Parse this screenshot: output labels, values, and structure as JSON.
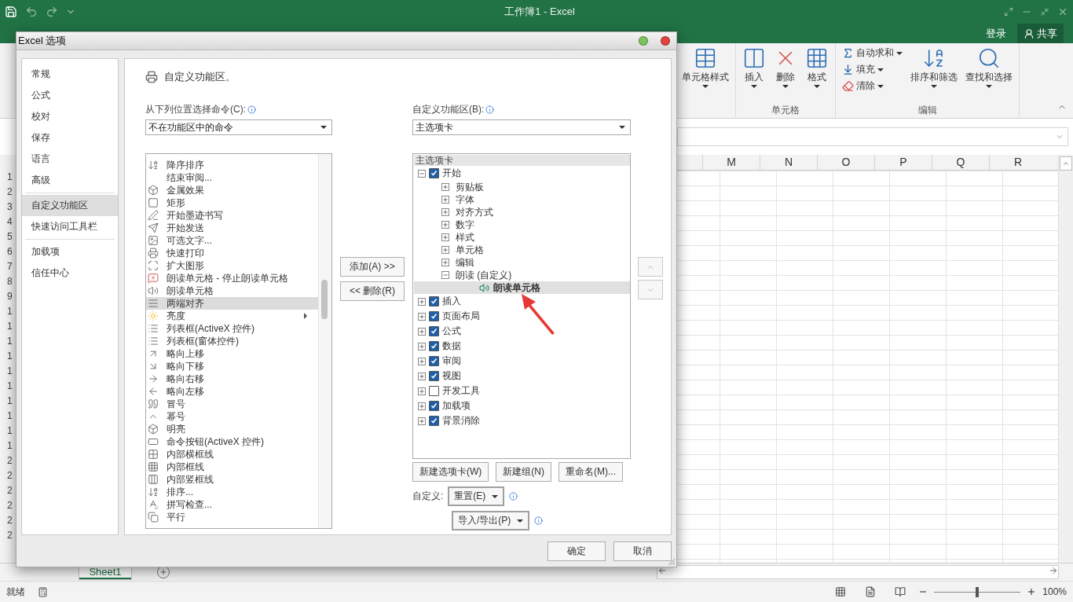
{
  "window": {
    "title": "工作簿1 - Excel",
    "sign_in": "登录",
    "share": "共享"
  },
  "ribbon": {
    "groups": [
      {
        "large": [
          {
            "label": "单元格样式",
            "has_menu": true
          }
        ]
      },
      {
        "label": "单元格",
        "large": [
          {
            "label": "插入",
            "has_menu": true
          },
          {
            "label": "删除",
            "has_menu": true
          },
          {
            "label": "格式",
            "has_menu": true
          }
        ]
      },
      {
        "label": "编辑",
        "small": [
          {
            "label": "自动求和",
            "has_menu": true
          },
          {
            "label": "填充",
            "has_menu": true
          },
          {
            "label": "清除",
            "has_menu": true
          }
        ],
        "large": [
          {
            "label": "排序和筛选",
            "has_menu": true
          },
          {
            "label": "查找和选择",
            "has_menu": true
          }
        ]
      }
    ]
  },
  "columns": [
    "M",
    "N",
    "O",
    "P",
    "Q",
    "R"
  ],
  "row_headers": [
    "1",
    "2",
    "3",
    "4",
    "5",
    "6",
    "7",
    "8",
    "9",
    "1",
    "1",
    "1",
    "1",
    "1",
    "1",
    "1",
    "1",
    "1",
    "1",
    "2",
    "2",
    "2",
    "2",
    "2",
    "2"
  ],
  "sheet_tabs": [
    {
      "label": "Sheet1",
      "selected": true
    }
  ],
  "status_bar": {
    "text": "就绪",
    "zoom": "100%",
    "zoom_slider": {
      "level": 0.5
    }
  },
  "dialog": {
    "title": "Excel 选项",
    "nav": [
      {
        "label": "常规",
        "selected": false
      },
      {
        "label": "公式",
        "selected": false
      },
      {
        "label": "校对",
        "selected": false
      },
      {
        "label": "保存",
        "selected": false
      },
      {
        "label": "语言",
        "selected": false
      },
      {
        "label": "高级",
        "selected": false
      },
      {
        "label": "自定义功能区",
        "selected": true
      },
      {
        "label": "快速访问工具栏",
        "selected": false
      },
      {
        "label": "加载项",
        "selected": false
      },
      {
        "label": "信任中心",
        "selected": false
      }
    ],
    "heading": "自定义功能区。",
    "commands_label": "从下列位置选择命令(C):",
    "commands_source": "不在功能区中的命令",
    "commands": [
      {
        "label": "降序排序",
        "selected": false,
        "has_submenu": false
      },
      {
        "label": "结束审阅...",
        "selected": false,
        "has_submenu": false
      },
      {
        "label": "金属效果",
        "selected": false,
        "has_submenu": false
      },
      {
        "label": "矩形",
        "selected": false,
        "has_submenu": false
      },
      {
        "label": "开始墨迹书写",
        "selected": false,
        "has_submenu": false
      },
      {
        "label": "开始发送",
        "selected": false,
        "has_submenu": false
      },
      {
        "label": "可选文字...",
        "selected": false,
        "has_submenu": false
      },
      {
        "label": "快速打印",
        "selected": false,
        "has_submenu": false
      },
      {
        "label": "扩大图形",
        "selected": false,
        "has_submenu": false
      },
      {
        "label": "朗读单元格 - 停止朗读单元格",
        "selected": false,
        "has_submenu": false
      },
      {
        "label": "朗读单元格",
        "selected": false,
        "has_submenu": false
      },
      {
        "label": "两端对齐",
        "selected": true,
        "has_submenu": false
      },
      {
        "label": "亮度",
        "selected": false,
        "has_submenu": true
      },
      {
        "label": "列表框(ActiveX 控件)",
        "selected": false,
        "has_submenu": false
      },
      {
        "label": "列表框(窗体控件)",
        "selected": false,
        "has_submenu": false
      },
      {
        "label": "略向上移",
        "selected": false,
        "has_submenu": false
      },
      {
        "label": "略向下移",
        "selected": false,
        "has_submenu": false
      },
      {
        "label": "略向右移",
        "selected": false,
        "has_submenu": false
      },
      {
        "label": "略向左移",
        "selected": false,
        "has_submenu": false
      },
      {
        "label": "冒号",
        "selected": false,
        "has_submenu": false
      },
      {
        "label": "幂号",
        "selected": false,
        "has_submenu": false
      },
      {
        "label": "明亮",
        "selected": false,
        "has_submenu": false
      },
      {
        "label": "命令按钮(ActiveX 控件)",
        "selected": false,
        "has_submenu": false
      },
      {
        "label": "内部横框线",
        "selected": false,
        "has_submenu": false
      },
      {
        "label": "内部框线",
        "selected": false,
        "has_submenu": false
      },
      {
        "label": "内部竖框线",
        "selected": false,
        "has_submenu": false
      },
      {
        "label": "排序...",
        "selected": false,
        "has_submenu": false
      },
      {
        "label": "拼写检查...",
        "selected": false,
        "has_submenu": false
      },
      {
        "label": "平行",
        "selected": false,
        "has_submenu": false
      }
    ],
    "add_button": "添加(A) >>",
    "remove_button": "<< 删除(R)",
    "ribbon_label": "自定义功能区(B):",
    "ribbon_source": "主选项卡",
    "tree": {
      "header": "主选项卡",
      "nodes": [
        {
          "kind": "tab",
          "label": "开始",
          "checked": true,
          "expanded": true,
          "selected": false,
          "children": [
            {
              "kind": "group",
              "label": "剪贴板",
              "expanded": false,
              "selected": false
            },
            {
              "kind": "group",
              "label": "字体",
              "expanded": false,
              "selected": false
            },
            {
              "kind": "group",
              "label": "对齐方式",
              "expanded": false,
              "selected": false
            },
            {
              "kind": "group",
              "label": "数字",
              "expanded": false,
              "selected": false
            },
            {
              "kind": "group",
              "label": "样式",
              "expanded": false,
              "selected": false
            },
            {
              "kind": "group",
              "label": "单元格",
              "expanded": false,
              "selected": false
            },
            {
              "kind": "group",
              "label": "编辑",
              "expanded": false,
              "selected": false
            },
            {
              "kind": "group",
              "label": "朗读 (自定义)",
              "expanded": true,
              "selected": false,
              "children": [
                {
                  "kind": "command",
                  "label": "朗读单元格",
                  "selected": true
                }
              ]
            }
          ]
        },
        {
          "kind": "tab",
          "label": "插入",
          "checked": true,
          "expanded": false,
          "selected": false
        },
        {
          "kind": "tab",
          "label": "页面布局",
          "checked": true,
          "expanded": false,
          "selected": false
        },
        {
          "kind": "tab",
          "label": "公式",
          "checked": true,
          "expanded": false,
          "selected": false
        },
        {
          "kind": "tab",
          "label": "数据",
          "checked": true,
          "expanded": false,
          "selected": false
        },
        {
          "kind": "tab",
          "label": "审阅",
          "checked": true,
          "expanded": false,
          "selected": false
        },
        {
          "kind": "tab",
          "label": "视图",
          "checked": true,
          "expanded": false,
          "selected": false
        },
        {
          "kind": "tab",
          "label": "开发工具",
          "checked": false,
          "expanded": false,
          "selected": false
        },
        {
          "kind": "tab",
          "label": "加载项",
          "checked": true,
          "expanded": false,
          "selected": false
        },
        {
          "kind": "tab",
          "label": "背景消除",
          "checked": true,
          "expanded": false,
          "selected": false
        }
      ]
    },
    "tree_buttons": [
      "新建选项卡(W)",
      "新建组(N)",
      "重命名(M)..."
    ],
    "customize_label": "自定义:",
    "reset_button": "重置(E)",
    "import_export_button": "导入/导出(P)",
    "ok_button": "确定",
    "cancel_button": "取消"
  }
}
